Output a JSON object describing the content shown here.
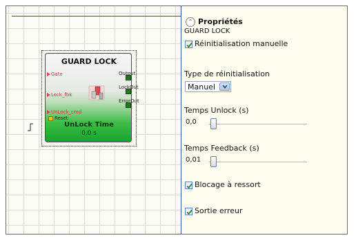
{
  "block": {
    "title": "GUARD LOCK",
    "inputs": [
      "Gate",
      "Lock_fbk",
      "UnLock_cmd"
    ],
    "outputs": [
      "Output",
      "LockOut",
      "ErrorOut"
    ],
    "reset_label": "Reset",
    "timer_label": "UnLock Time",
    "timer_value": "0,0 s"
  },
  "props": {
    "title": "Propriétés",
    "subtitle": "GUARD LOCK",
    "manual_reset": {
      "label": "Réinitialisation manuelle",
      "checked": true
    },
    "reset_type": {
      "label": "Type de réinitialisation",
      "value": "Manuel"
    },
    "unlock_time": {
      "label": "Temps Unlock (s)",
      "value": "0,0"
    },
    "feedback_time": {
      "label": "Temps Feedback (s)",
      "value": "0,01"
    },
    "spring_lock": {
      "label": "Blocage à ressort",
      "checked": true
    },
    "error_out": {
      "label": "Sortie erreur",
      "checked": true
    }
  },
  "colors": {
    "block_green": "#17a52c",
    "input_pin": "#d64646",
    "output_pin": "#1f7a1f",
    "reset_pin": "#e4c21c",
    "panel_bg": "#fffdf0"
  },
  "icons": [
    "collapse-chevron-icon",
    "guard-lock-icon",
    "edge-trigger-icon",
    "checkmark-icon",
    "dropdown-arrow-icon"
  ]
}
